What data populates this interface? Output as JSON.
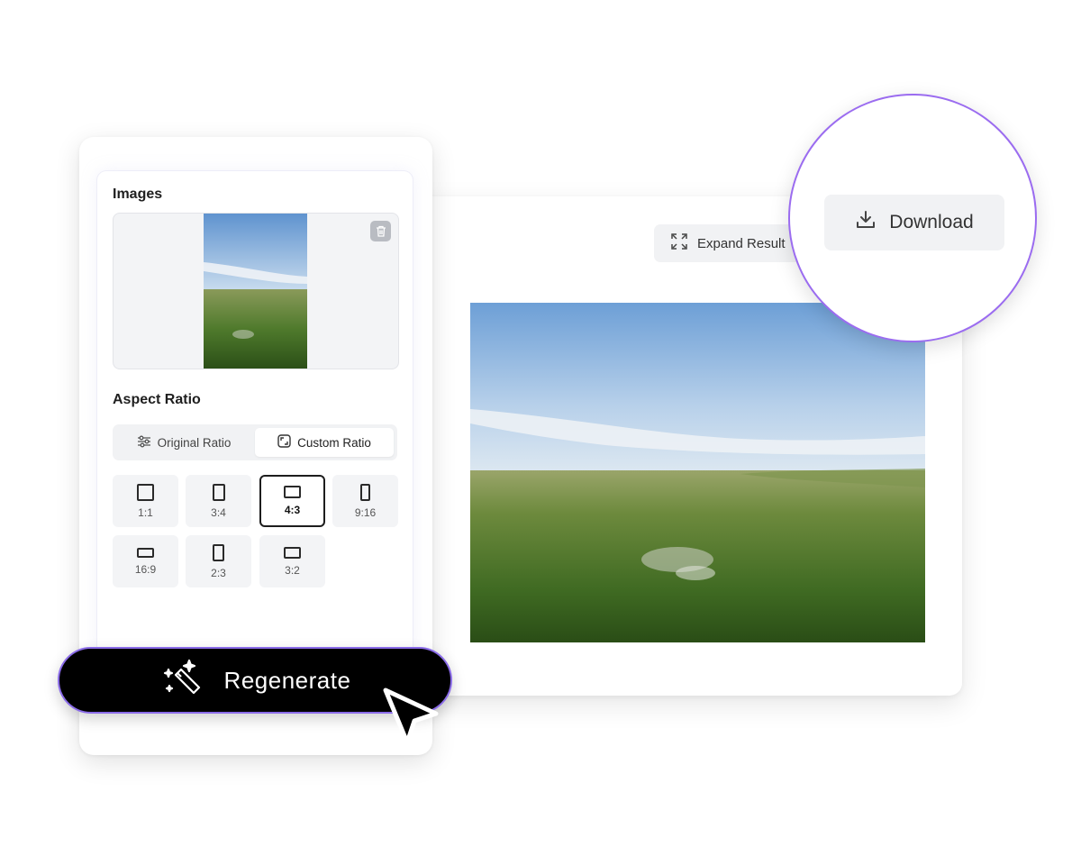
{
  "images_section": {
    "label": "Images"
  },
  "aspect_section": {
    "label": "Aspect Ratio"
  },
  "ratio_toggle": {
    "original": "Original Ratio",
    "custom": "Custom Ratio",
    "active": "custom"
  },
  "ratios": [
    {
      "label": "1:1",
      "selected": false
    },
    {
      "label": "3:4",
      "selected": false
    },
    {
      "label": "4:3",
      "selected": true
    },
    {
      "label": "9:16",
      "selected": false
    },
    {
      "label": "16:9",
      "selected": false
    },
    {
      "label": "2:3",
      "selected": false
    },
    {
      "label": "3:2",
      "selected": false
    }
  ],
  "result": {
    "expand_label": "Expand Result"
  },
  "download": {
    "label": "Download"
  },
  "regenerate": {
    "label": "Regenerate"
  },
  "colors": {
    "accent_border": "#9b6cf0",
    "button_bg": "#000000"
  },
  "icons": [
    "delete-icon",
    "sliders-icon",
    "custom-ratio-icon",
    "expand-icon",
    "download-icon",
    "magic-wand-icon",
    "cursor-pointer-icon"
  ]
}
